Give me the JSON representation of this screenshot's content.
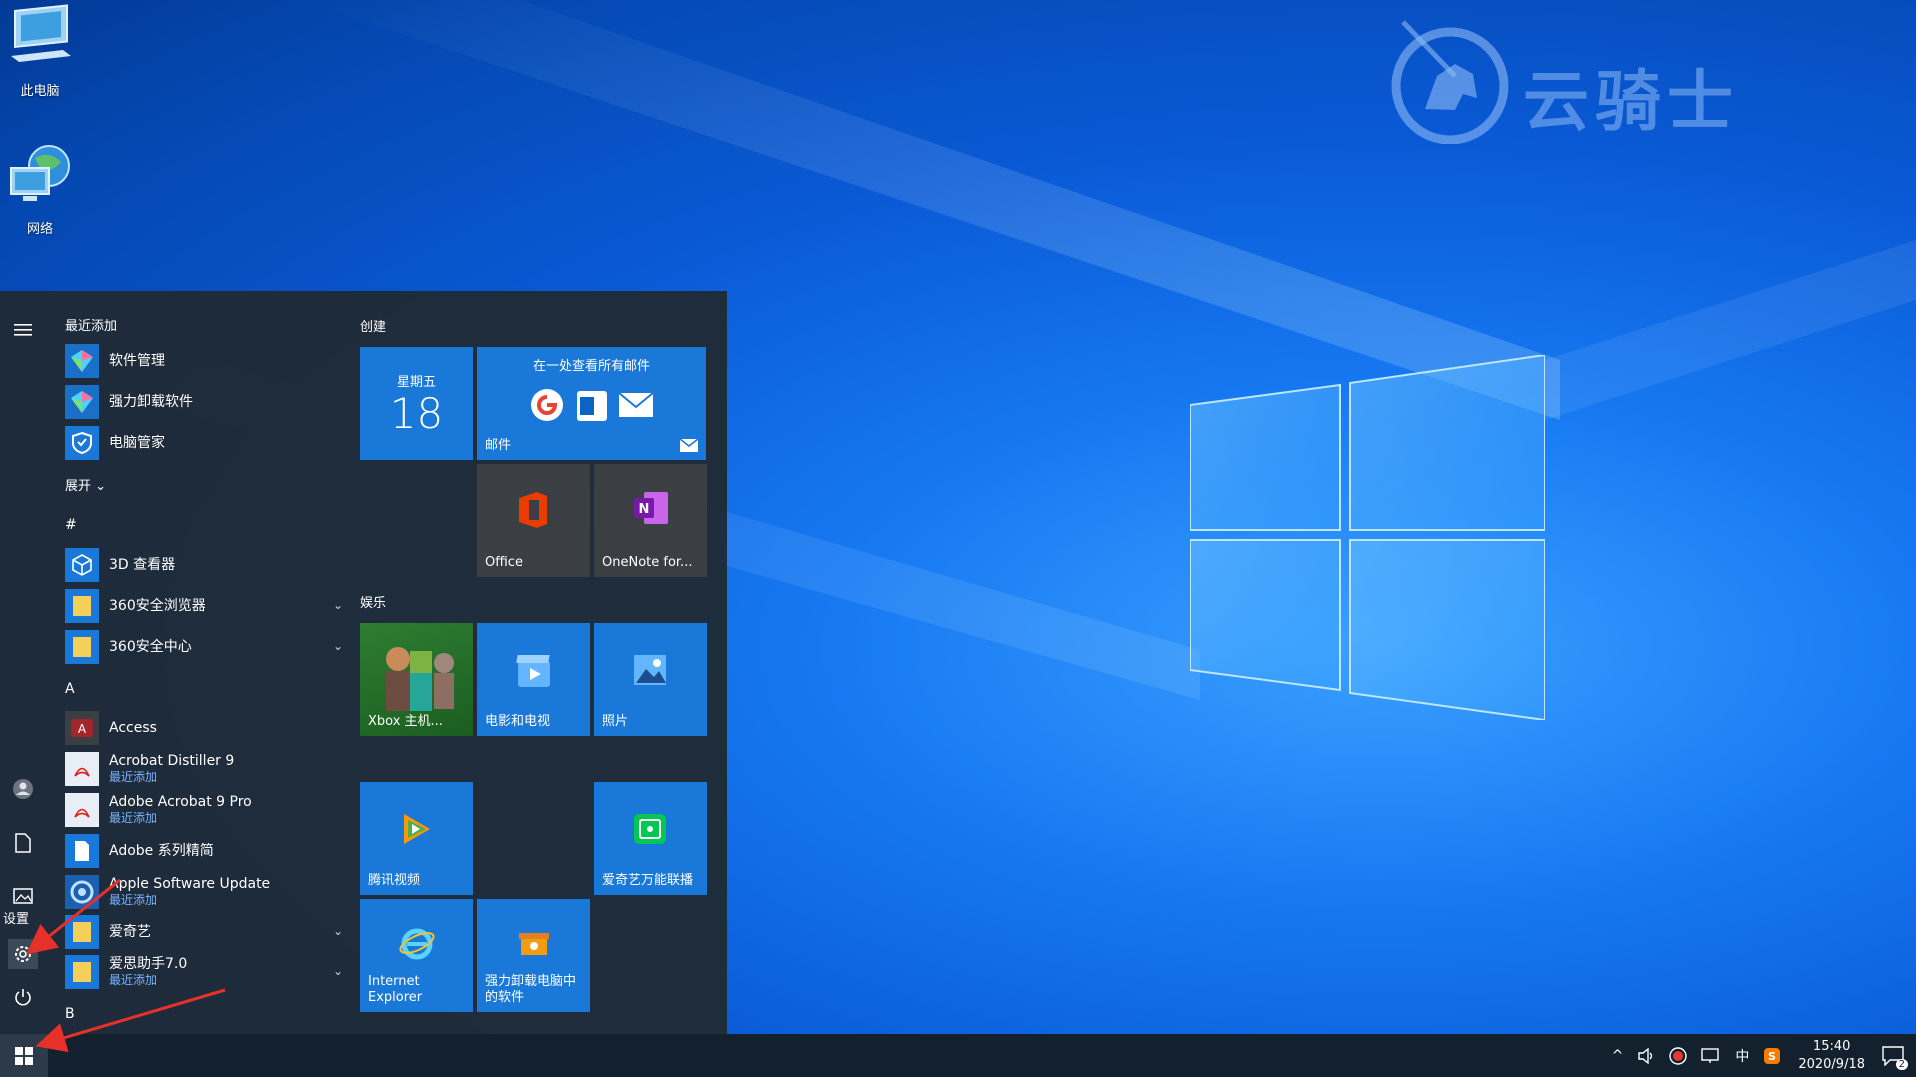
{
  "desktop": {
    "icons": [
      {
        "label": "此电脑"
      },
      {
        "label": "网络"
      }
    ],
    "watermark": "云骑士"
  },
  "start_menu": {
    "tooltip": "设置",
    "recent": {
      "header": "最近添加",
      "items": [
        {
          "label": "软件管理"
        },
        {
          "label": "强力卸载软件"
        },
        {
          "label": "电脑管家"
        }
      ],
      "expand": "展开"
    },
    "sections": {
      "hash": "#",
      "a": "A",
      "b": "B"
    },
    "apps": [
      {
        "label": "3D 查看器",
        "sub": ""
      },
      {
        "label": "360安全浏览器",
        "sub": ""
      },
      {
        "label": "360安全中心",
        "sub": ""
      },
      {
        "label": "Access",
        "sub": ""
      },
      {
        "label": "Acrobat Distiller 9",
        "sub": "最近添加"
      },
      {
        "label": "Adobe Acrobat 9 Pro",
        "sub": "最近添加"
      },
      {
        "label": "Adobe 系列精简",
        "sub": ""
      },
      {
        "label": "Apple Software Update",
        "sub": "最近添加"
      },
      {
        "label": "爱奇艺",
        "sub": ""
      },
      {
        "label": "爱思助手7.0",
        "sub": "最近添加"
      }
    ],
    "tiles": {
      "group_create": "创建",
      "group_entertainment": "娱乐",
      "calendar": {
        "weekday": "星期五",
        "day": "18"
      },
      "mail": {
        "title": "在一处查看所有邮件",
        "label": "邮件"
      },
      "office": "Office",
      "onenote": "OneNote for...",
      "xbox": "Xbox 主机...",
      "movies": "电影和电视",
      "photos": "照片",
      "tencent": "腾讯视频",
      "iqiyi_cast": "爱奇艺万能联播",
      "ie": "Internet Explorer",
      "uninstall": "强力卸载电脑中的软件"
    }
  },
  "taskbar": {
    "ime": "中",
    "time": "15:40",
    "date": "2020/9/18",
    "notifications": "2"
  },
  "colors": {
    "accent": "#1a78d8",
    "menu_bg": "#1f2a36",
    "arrow": "#e8302a"
  }
}
